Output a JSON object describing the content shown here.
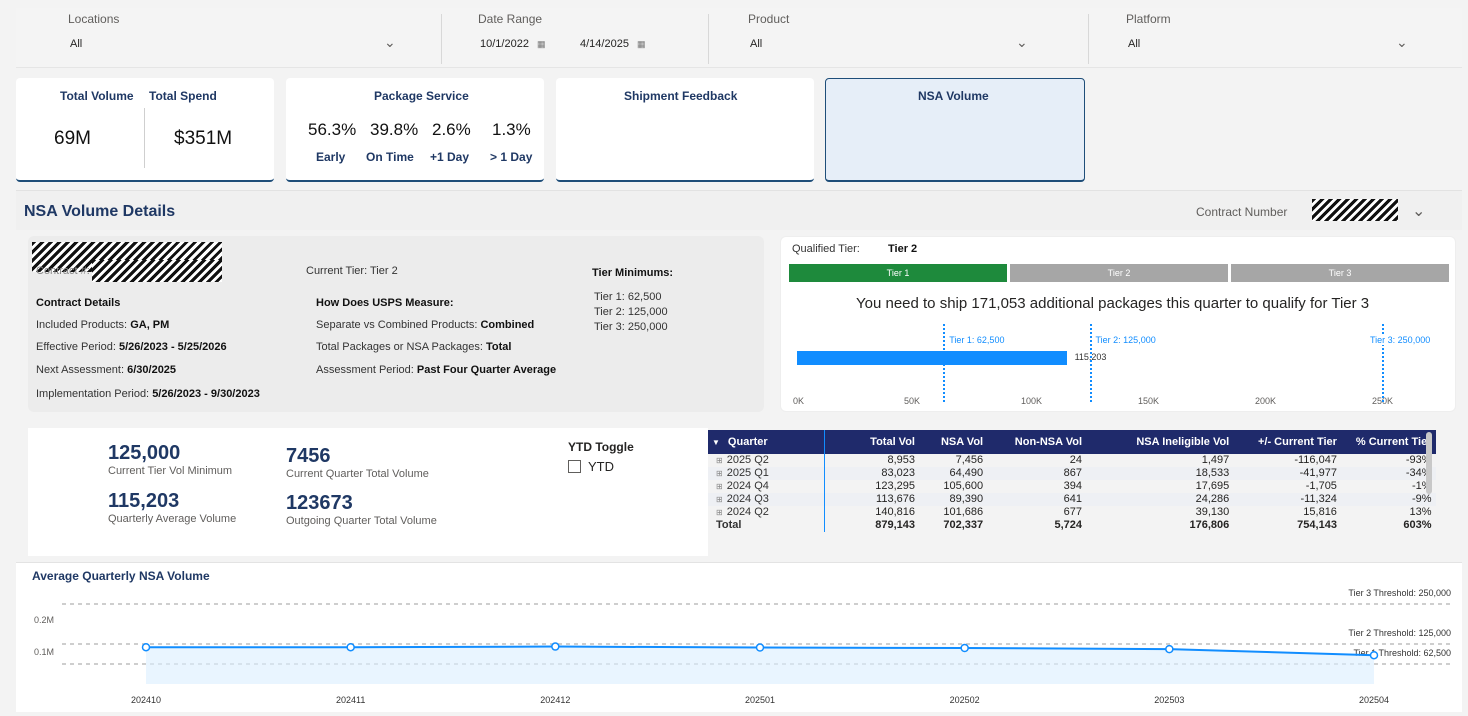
{
  "filters": {
    "locations": {
      "label": "Locations",
      "value": "All"
    },
    "date_range": {
      "label": "Date Range",
      "start": "10/1/2022",
      "end": "4/14/2025"
    },
    "product": {
      "label": "Product",
      "value": "All"
    },
    "platform": {
      "label": "Platform",
      "value": "All"
    }
  },
  "kpis": {
    "total_volume": {
      "label": "Total Volume",
      "value": "69M"
    },
    "total_spend": {
      "label": "Total Spend",
      "value": "$351M"
    },
    "package_service": {
      "label": "Package Service",
      "items": [
        {
          "pct": "56.3%",
          "label": "Early"
        },
        {
          "pct": "39.8%",
          "label": "On Time"
        },
        {
          "pct": "2.6%",
          "label": "+1 Day"
        },
        {
          "pct": "1.3%",
          "label": "> 1 Day"
        }
      ]
    },
    "shipment_feedback": {
      "label": "Shipment Feedback"
    },
    "nsa_volume": {
      "label": "NSA Volume"
    }
  },
  "section": {
    "title": "NSA Volume Details",
    "contract_number_label": "Contract Number"
  },
  "contract": {
    "contract_label": "Contract #:",
    "details_header": "Contract Details",
    "included_products_label": "Included Products:",
    "included_products": "GA, PM",
    "effective_label": "Effective Period:",
    "effective": "5/26/2023 - 5/25/2026",
    "next_label": "Next Assessment:",
    "next": "6/30/2025",
    "impl_label": "Implementation Period:",
    "impl": "5/26/2023 - 9/30/2023",
    "current_tier_label": "Current Tier:",
    "current_tier": "Tier 2",
    "measure_header": "How Does USPS Measure:",
    "sep_label": "Separate vs Combined Products:",
    "sep": "Combined",
    "total_label": "Total Packages or NSA Packages:",
    "total": "Total",
    "assess_label": "Assessment Period:",
    "assess": "Past Four Quarter Average",
    "tier_min_header": "Tier Minimums:",
    "tier_mins": [
      "Tier 1: 62,500",
      "Tier 2: 125,000",
      "Tier 3: 250,000"
    ]
  },
  "tier": {
    "qualified_label": "Qualified Tier:",
    "qualified": "Tier 2",
    "bars": [
      {
        "label": "Tier 1",
        "color": "#1e8a3c"
      },
      {
        "label": "Tier 2",
        "color": "#a6a6a6"
      },
      {
        "label": "Tier 3",
        "color": "#a6a6a6"
      }
    ],
    "message": "You need to ship 171,053 additional packages this quarter to qualify for Tier 3",
    "progress_value": 115203,
    "progress_label": "115,203",
    "axis_max": 250000,
    "axis_ticks": [
      "0K",
      "50K",
      "100K",
      "150K",
      "200K",
      "250K"
    ],
    "thresholds": [
      {
        "value": 62500,
        "label": "Tier 1: 62,500"
      },
      {
        "value": 125000,
        "label": "Tier 2: 125,000"
      },
      {
        "value": 250000,
        "label": "Tier 3: 250,000"
      }
    ]
  },
  "stats": {
    "current_tier_min": {
      "value": "125,000",
      "label": "Current Tier Vol Minimum"
    },
    "quarterly_avg": {
      "value": "115,203",
      "label": "Quarterly Average Volume"
    },
    "current_quarter": {
      "value": "7456",
      "label": "Current Quarter Total Volume"
    },
    "outgoing_quarter": {
      "value": "123673",
      "label": "Outgoing Quarter Total Volume"
    },
    "ytd_toggle_label": "YTD Toggle",
    "ytd_label": "YTD"
  },
  "table": {
    "headers": [
      "Quarter",
      "Total Vol",
      "NSA Vol",
      "Non-NSA Vol",
      "NSA Ineligible Vol",
      "+/- Current Tier",
      "% Current Tier"
    ],
    "rows": [
      [
        "2025 Q2",
        "8,953",
        "7,456",
        "24",
        "1,497",
        "-116,047",
        "-93%"
      ],
      [
        "2025 Q1",
        "83,023",
        "64,490",
        "867",
        "18,533",
        "-41,977",
        "-34%"
      ],
      [
        "2024 Q4",
        "123,295",
        "105,600",
        "394",
        "17,695",
        "-1,705",
        "-1%"
      ],
      [
        "2024 Q3",
        "113,676",
        "89,390",
        "641",
        "24,286",
        "-11,324",
        "-9%"
      ],
      [
        "2024 Q2",
        "140,816",
        "101,686",
        "677",
        "39,130",
        "15,816",
        "13%"
      ]
    ],
    "total": [
      "Total",
      "879,143",
      "702,337",
      "5,724",
      "176,806",
      "754,143",
      "603%"
    ]
  },
  "chart_data": {
    "type": "line",
    "title": "Average Quarterly NSA Volume",
    "categories": [
      "202410",
      "202411",
      "202412",
      "202501",
      "202502",
      "202503",
      "202504"
    ],
    "values": [
      115000,
      115000,
      117000,
      114000,
      112500,
      109000,
      90000
    ],
    "ylim": [
      0,
      250000
    ],
    "yticks": [
      {
        "value": 100000,
        "label": "0.1M"
      },
      {
        "value": 200000,
        "label": "0.2M"
      }
    ],
    "thresholds": [
      {
        "value": 250000,
        "label": "Tier 3 Threshold: 250,000"
      },
      {
        "value": 125000,
        "label": "Tier 2 Threshold: 125,000"
      },
      {
        "value": 62500,
        "label": "Tier 1 Threshold: 62,500"
      }
    ],
    "line_color": "#118dff",
    "grid": true
  }
}
